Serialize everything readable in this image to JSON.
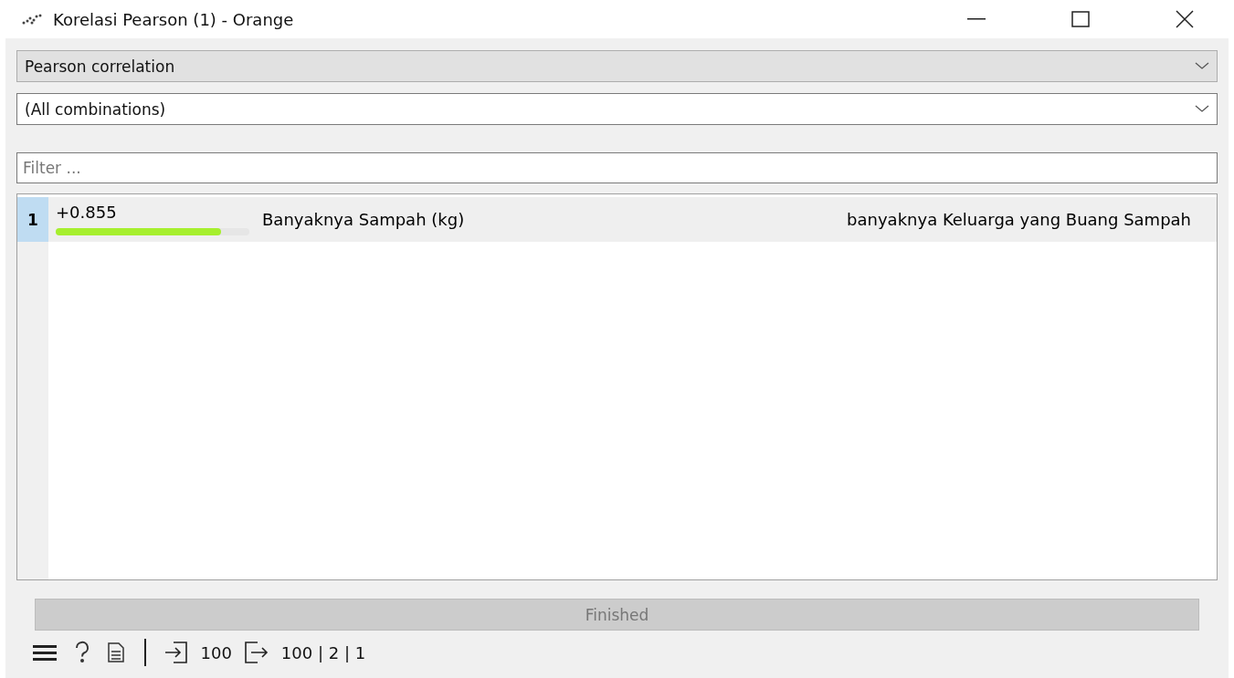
{
  "window": {
    "title": "Korelasi Pearson (1) - Orange"
  },
  "method": {
    "value": "Pearson correlation"
  },
  "combinations": {
    "value": "(All combinations)"
  },
  "filter": {
    "placeholder": "Filter ..."
  },
  "rows": [
    {
      "index": "1",
      "selected": true,
      "correlation": "+0.855",
      "level": 0.855,
      "feature_1": "Banyaknya Sampah (kg)",
      "feature_2": "banyaknya Keluarga yang Buang Sampah"
    }
  ],
  "progress": {
    "text": "Finished",
    "level": 1
  },
  "status_bar": {
    "input": "100",
    "output": "100 | 2 | 1"
  }
}
